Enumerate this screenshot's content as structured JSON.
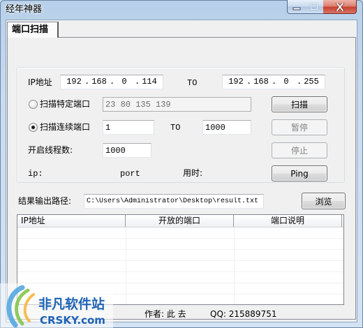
{
  "window": {
    "title": "经年神器",
    "controls": {
      "minimize_icon": "minimize-icon",
      "maximize_icon": "maximize-icon",
      "close_icon": "close-icon"
    }
  },
  "tabs": [
    {
      "label": "端口扫描",
      "selected": true
    }
  ],
  "scan": {
    "ip_label": "IP地址",
    "ip_from": [
      "192",
      "168",
      "0",
      "114"
    ],
    "ip_separator": ".",
    "ip_to_label": "TO",
    "ip_to": [
      "192",
      "168",
      "0",
      "255"
    ],
    "specific": {
      "label": "扫描特定端口",
      "checked": false,
      "ports": "23 80 135 139",
      "disabled": true
    },
    "range": {
      "label": "扫描连续端口",
      "checked": true,
      "from": "1",
      "to_label": "TO",
      "to": "1000"
    },
    "threads_label": "开启线程数:",
    "threads": "1000",
    "buttons": {
      "scan": {
        "label": "扫描",
        "disabled": false
      },
      "pause": {
        "label": "暂停",
        "disabled": true
      },
      "stop": {
        "label": "停止",
        "disabled": true
      },
      "ping": {
        "label": "Ping",
        "disabled": false
      }
    },
    "status": {
      "ip_label": "ip:",
      "port_label": "port",
      "elapsed_label": "用时:"
    }
  },
  "output": {
    "label": "结果输出路径:",
    "path": "C:\\Users\\Administrator\\Desktop\\result.txt",
    "browse": "浏览"
  },
  "results": {
    "columns": [
      "IP地址",
      "开放的端口",
      "端口说明"
    ],
    "rows": []
  },
  "footer": {
    "author": "作者: 此  去",
    "qq": "QQ: 215889751"
  },
  "watermark": {
    "site": "非凡软件站",
    "domain": "CRSKY.com",
    "logo_icon": "crsky-logo-icon"
  },
  "colors": {
    "client_bg": "#f0f0f0",
    "close_button": "#c8412e",
    "watermark_text": "#1f63b4"
  }
}
